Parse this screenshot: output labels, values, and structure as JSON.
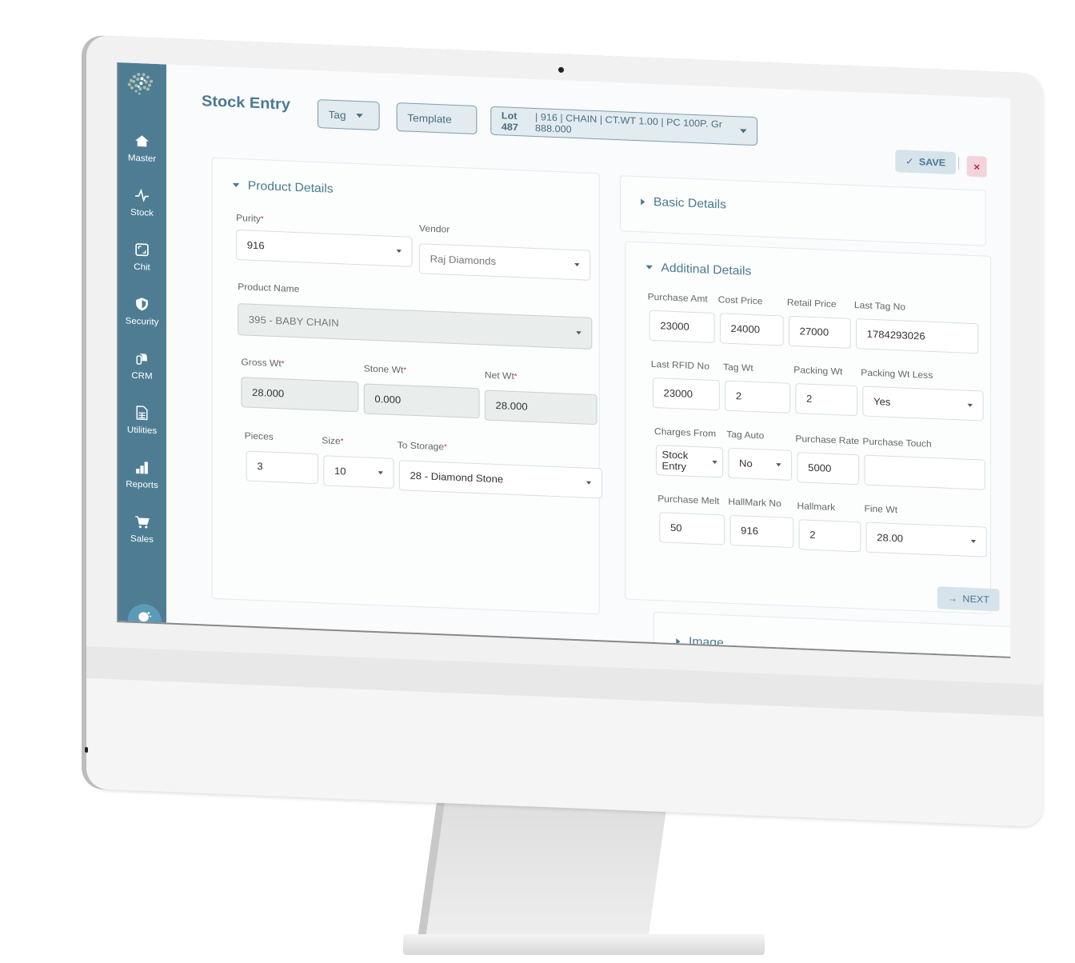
{
  "sidebar": {
    "items": [
      {
        "label": "Master",
        "icon": "home-icon"
      },
      {
        "label": "Stock",
        "icon": "activity-icon"
      },
      {
        "label": "Chit",
        "icon": "expand-icon"
      },
      {
        "label": "Security",
        "icon": "shield-icon"
      },
      {
        "label": "CRM",
        "icon": "crm-icon"
      },
      {
        "label": "Utilities",
        "icon": "spreadsheet-icon"
      },
      {
        "label": "Reports",
        "icon": "bar-chart-icon"
      },
      {
        "label": "Sales",
        "icon": "cart-icon"
      }
    ]
  },
  "header": {
    "title": "Stock Entry",
    "tag_label": "Tag",
    "template_label": "Template",
    "lot": {
      "prefix": "Lot 487",
      "details": "| 916 | CHAIN | CT.WT 1.00 | PC 100P. Gr 888.000"
    },
    "save_label": "SAVE",
    "close_label": "×"
  },
  "product_details": {
    "title": "Product Details",
    "purity": {
      "label": "Purity",
      "value": "916"
    },
    "vendor": {
      "label": "Vendor",
      "value": "Raj Diamonds"
    },
    "product_name": {
      "label": "Product Name",
      "value": "395 - BABY CHAIN"
    },
    "gross_wt": {
      "label": "Gross Wt",
      "value": "28.000"
    },
    "stone_wt": {
      "label": "Stone Wt",
      "value": "0.000"
    },
    "net_wt": {
      "label": "Net Wt",
      "value": "28.000"
    },
    "pieces": {
      "label": "Pieces",
      "value": "3"
    },
    "size": {
      "label": "Size",
      "value": "10"
    },
    "to_storage": {
      "label": "To Storage",
      "value": "28 - Diamond Stone"
    }
  },
  "basic_details": {
    "title": "Basic Details"
  },
  "additional_details": {
    "title": "Additinal Details",
    "purchase_amt": {
      "label": "Purchase Amt",
      "value": "23000"
    },
    "cost_price": {
      "label": "Cost Price",
      "value": "24000"
    },
    "retail_price": {
      "label": "Retail Price",
      "value": "27000"
    },
    "last_tag_no": {
      "label": "Last Tag No",
      "value": "1784293026"
    },
    "last_rfid_no": {
      "label": "Last RFID No",
      "value": "23000"
    },
    "tag_wt": {
      "label": "Tag Wt",
      "value": "2"
    },
    "packing_wt": {
      "label": "Packing Wt",
      "value": "2"
    },
    "packing_wt_less": {
      "label": "Packing Wt Less",
      "value": "Yes"
    },
    "charges_from": {
      "label": "Charges From",
      "value": "Stock Entry"
    },
    "tag_auto": {
      "label": "Tag Auto",
      "value": "No"
    },
    "purchase_rate": {
      "label": "Purchase Rate",
      "value": "5000"
    },
    "purchase_touch": {
      "label": "Purchase Touch",
      "value": ""
    },
    "purchase_melt": {
      "label": "Purchase Melt",
      "value": "50"
    },
    "hallmark_no": {
      "label": "HallMark No",
      "value": "916"
    },
    "hallmark": {
      "label": "Hallmark",
      "value": "2"
    },
    "fine_wt": {
      "label": "Fine Wt",
      "value": "28.00"
    },
    "next_label": "NEXT"
  },
  "image_section": {
    "title": "Image"
  },
  "colors": {
    "sidebar": "#4e7d93",
    "accent": "#4a7a90",
    "danger": "#c0284a"
  }
}
